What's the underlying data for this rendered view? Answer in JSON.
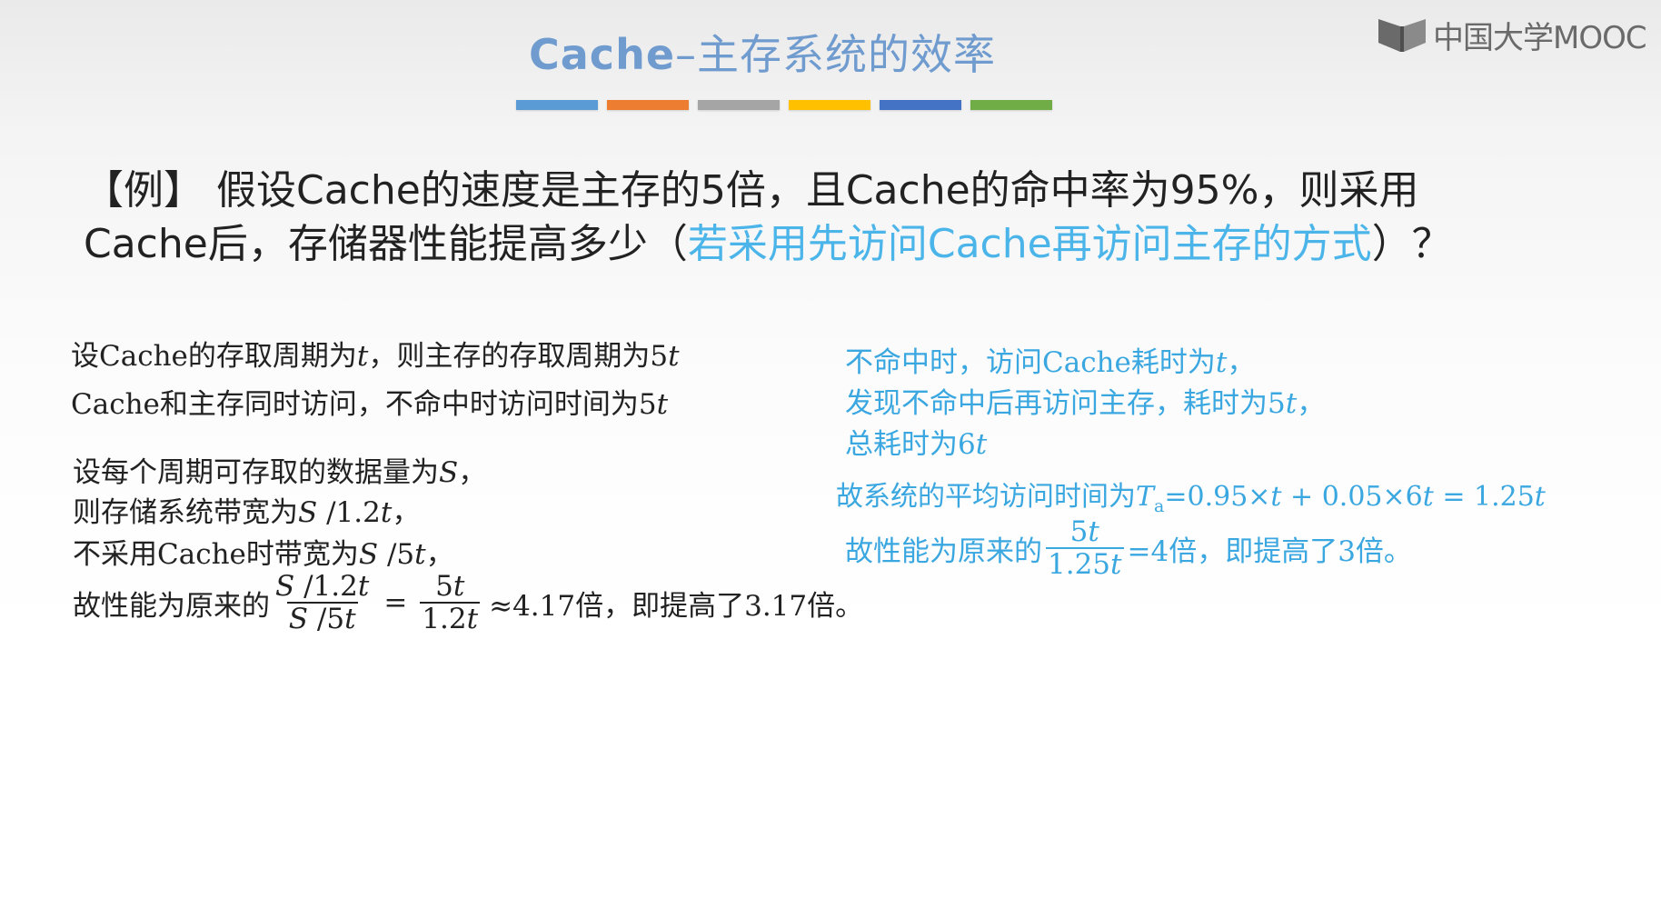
{
  "slide": {
    "title_prefix": "Cache",
    "title_suffix": "–主存系统的效率"
  },
  "colors": {
    "bar": [
      "#5b9bd5",
      "#ed7d31",
      "#a5a5a5",
      "#ffc000",
      "#4472c4",
      "#70ad47"
    ],
    "title": "#6f9bcf",
    "highlight": "#4bb5ea"
  },
  "logo": {
    "text": "中国大学MOOC",
    "icon": "mooc-book-icon"
  },
  "problem": {
    "lead": "【例】 假设Cache的速度是主存的5倍，且Cache的命中率为95%，则采用Cache后，存储器性能提高多少（",
    "highlight": "若采用先访问Cache再访问主存的方式",
    "tail": "）？"
  },
  "left": {
    "line1": {
      "a": "设Cache的存取周期为",
      "b": "t",
      "c": "，则主存的存取周期为5",
      "d": "t"
    },
    "line2": {
      "a": "Cache和主存同时访问，不命中时访问时间为5",
      "b": "t"
    },
    "line3": {
      "a": "设每个周期可存取的数据量为",
      "b": "S",
      "c": "，"
    },
    "line4": {
      "a": "则存储系统带宽为",
      "b": "S",
      "c": " /1.2",
      "d": "t",
      "e": "，"
    },
    "line5": {
      "a": "不采用Cache时带宽为",
      "b": "S",
      "c": " /5",
      "d": "t",
      "e": "，"
    },
    "line6": {
      "a": "故性能为原来的",
      "f1_num_a": "S",
      "f1_num_b": " /1.2",
      "f1_num_c": "t",
      "f1_den_a": "S",
      "f1_den_b": " /5",
      "f1_den_c": "t",
      "eq": "=",
      "f2_num_a": "5",
      "f2_num_b": "t",
      "f2_den_a": "1.2",
      "f2_den_b": "t",
      "tail": "≈4.17倍，即提高了3.17倍。"
    }
  },
  "right": {
    "line1": {
      "a": "不命中时，访问Cache耗时为",
      "b": "t",
      "c": "，"
    },
    "line2": {
      "a": "发现不命中后再访问主存，耗时为5",
      "b": "t",
      "c": "，"
    },
    "line3": {
      "a": "总耗时为6",
      "b": "t"
    },
    "line4": {
      "a": "故系统的平均访问时间为",
      "b": "T",
      "sub": "a",
      "c": "=0.95×",
      "d": "t",
      "e": " + 0.05×6",
      "f": "t",
      "g": " = 1.25",
      "h": "t"
    },
    "line5": {
      "a": "故性能为原来的",
      "num_a": "5",
      "num_b": "t",
      "den_a": "1.25",
      "den_b": "t",
      "tail": " =4倍，即提高了3倍。"
    }
  }
}
